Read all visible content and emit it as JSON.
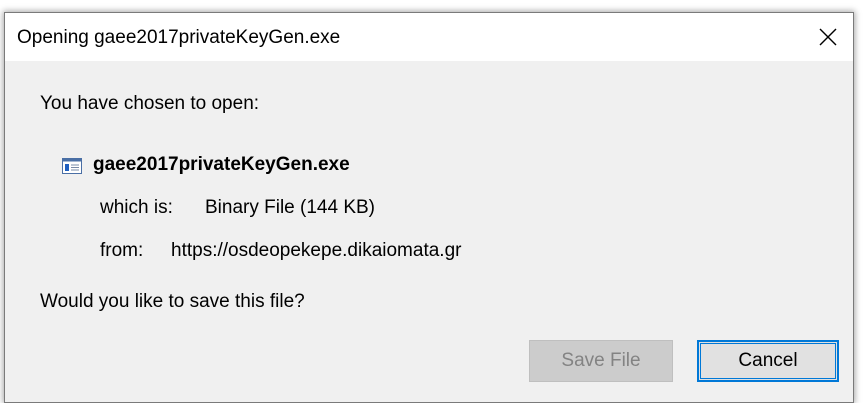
{
  "window": {
    "title": "Opening gaee2017privateKeyGen.exe",
    "close_icon": "close-icon"
  },
  "content": {
    "intro": "You have chosen to open:",
    "file": {
      "icon": "executable-file-icon",
      "name": "gaee2017privateKeyGen.exe"
    },
    "type_label": "which is:",
    "type_value": "Binary File (144 KB)",
    "from_label": "from:",
    "from_value": "https://osdeopekepe.dikaiomata.gr",
    "question": "Would you like to save this file?"
  },
  "buttons": {
    "save_label": "Save File",
    "save_enabled": false,
    "cancel_label": "Cancel"
  },
  "colors": {
    "dialog_background": "#f0f0f0",
    "focus_accent": "#0078d7",
    "disabled_text": "#838383"
  }
}
